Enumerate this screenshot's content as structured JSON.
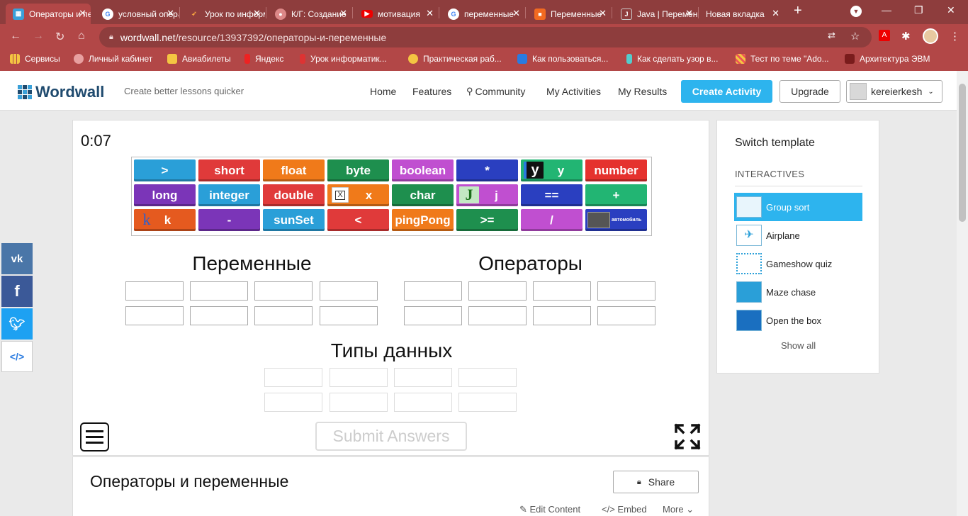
{
  "browser": {
    "tabs": [
      {
        "title": "Операторы и переменные",
        "fav": "wordwall-icon",
        "active": true
      },
      {
        "title": "условный оператор",
        "fav": "google-icon"
      },
      {
        "title": "Урок по информатике",
        "fav": "lesson-icon"
      },
      {
        "title": "К/Г: Создание",
        "fav": "web-icon"
      },
      {
        "title": "мотивация",
        "fav": "youtube-icon"
      },
      {
        "title": "переменные",
        "fav": "google-icon"
      },
      {
        "title": "Переменные",
        "fav": "site-icon"
      },
      {
        "title": "Java | Переменные",
        "fav": "java-icon"
      },
      {
        "title": "Новая вкладка",
        "fav": "none"
      }
    ],
    "url_host": "wordwall.net",
    "url_path": "/resource/13937392/операторы-и-переменные",
    "bookmarks": [
      "Сервисы",
      "Личный кабинет",
      "Авиабилеты",
      "Яндекс",
      "Урок информатик...",
      "Практическая раб...",
      "Как пользоваться...",
      "Как сделать узор в...",
      "Тест по теме \"Ado...",
      "Архитектура ЭВМ"
    ]
  },
  "header": {
    "logo": "Wordwall",
    "tagline": "Create better lessons quicker",
    "nav": {
      "home": "Home",
      "features": "Features",
      "community": "Community",
      "my_activities": "My Activities",
      "my_results": "My Results"
    },
    "create": "Create Activity",
    "upgrade": "Upgrade",
    "username": "kereierkesh"
  },
  "game": {
    "timer": "0:07",
    "tiles": [
      {
        "label": ">",
        "color": "#2a9fd8"
      },
      {
        "label": "short",
        "color": "#e03a3a"
      },
      {
        "label": "float",
        "color": "#f07a1a"
      },
      {
        "label": "byte",
        "color": "#1e8f4e"
      },
      {
        "label": "boolean",
        "color": "#c04fd0"
      },
      {
        "label": "*",
        "color": "#2a3fc0"
      },
      {
        "label": "y",
        "color": "#22b573",
        "img": true
      },
      {
        "label": "number",
        "color": "#e5322e"
      },
      {
        "label": "long",
        "color": "#7b35b8"
      },
      {
        "label": "integer",
        "color": "#2a9fd8"
      },
      {
        "label": "double",
        "color": "#e03a3a"
      },
      {
        "label": "x",
        "color": "#f07a1a",
        "img": true
      },
      {
        "label": "char",
        "color": "#1e8f4e"
      },
      {
        "label": "j",
        "color": "#c04fd0",
        "img": true
      },
      {
        "label": "==",
        "color": "#2a3fc0"
      },
      {
        "label": "+",
        "color": "#22b573"
      },
      {
        "label": "k",
        "color": "#e55a1f",
        "img": true
      },
      {
        "label": "-",
        "color": "#7b35b8"
      },
      {
        "label": "sunSet",
        "color": "#2a9fd8"
      },
      {
        "label": "<",
        "color": "#e03a3a"
      },
      {
        "label": "pingPong",
        "color": "#f07a1a"
      },
      {
        "label": ">=",
        "color": "#1e8f4e"
      },
      {
        "label": "/",
        "color": "#c04fd0"
      },
      {
        "label": "автомобиль",
        "color": "#2a3fc0",
        "img": true
      }
    ],
    "groups": [
      "Переменные",
      "Операторы",
      "Типы данных"
    ],
    "submit": "Submit Answers"
  },
  "activity": {
    "title": "Операторы и переменные",
    "share": "Share",
    "edit": "Edit Content",
    "embed": "Embed",
    "more": "More"
  },
  "sidebar": {
    "switch": "Switch template",
    "section": "INTERACTIVES",
    "templates": [
      "Group sort",
      "Airplane",
      "Gameshow quiz",
      "Maze chase",
      "Open the box"
    ],
    "show_all": "Show all"
  },
  "social": [
    "vk-icon",
    "facebook-icon",
    "twitter-icon",
    "embed-code-icon"
  ]
}
